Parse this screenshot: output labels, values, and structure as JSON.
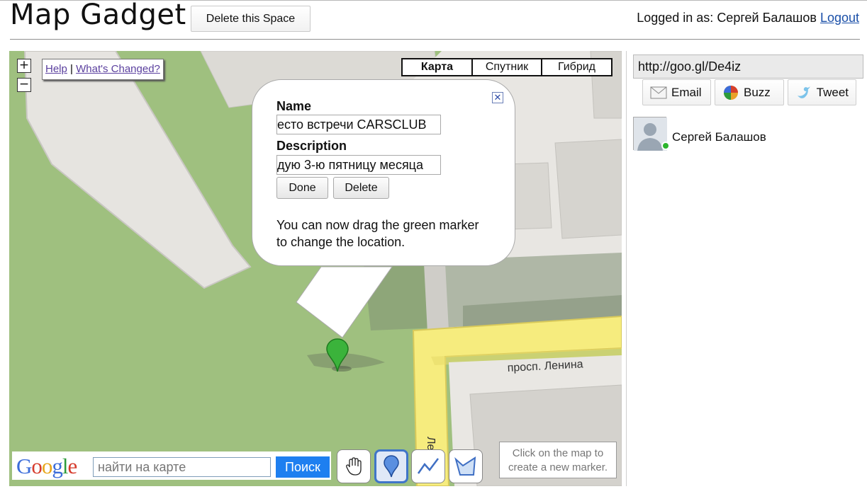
{
  "header": {
    "app_title": "Map Gadget",
    "delete_space_label": "Delete this Space",
    "logged_in_prefix": "Logged in as:",
    "user_name": "Сергей Балашов",
    "logout_label": "Logout"
  },
  "map": {
    "zoom_in_label": "+",
    "zoom_out_label": "−",
    "help_label": "Help",
    "help_separator": "|",
    "whats_changed_label": "What's Changed?",
    "map_types": [
      "Карта",
      "Спутник",
      "Гибрид"
    ],
    "selected_map_type": "Карта",
    "street_label_main": "просп. Ленина",
    "street_label_side": "Ле",
    "infowindow": {
      "name_label": "Name",
      "name_value": "есто встречи CARSCLUB",
      "description_label": "Description",
      "description_value": "дую 3-ю пятницу месяца",
      "done_label": "Done",
      "delete_label": "Delete",
      "note": "You can now drag the green marker to change the location."
    },
    "search": {
      "logo_text": "Google",
      "placeholder": "найти на карте",
      "button_label": "Поиск"
    },
    "tools": [
      "hand-icon",
      "marker-icon",
      "line-icon",
      "polygon-icon"
    ],
    "click_hint": "Click on the map to create a new marker."
  },
  "sidebar": {
    "short_url": "http://goo.gl/De4iz",
    "share_buttons": [
      {
        "label": "Email",
        "icon": "envelope-icon"
      },
      {
        "label": "Buzz",
        "icon": "buzz-icon"
      },
      {
        "label": "Tweet",
        "icon": "twitter-bird-icon"
      }
    ],
    "participant_name": "Сергей Балашов",
    "presence_color": "#2cb52c"
  },
  "colors": {
    "map_green": "#9fc07f",
    "road_yellow": "#f6ec7e",
    "search_blue": "#1e7ff0",
    "marker_green": "#3bb33b"
  }
}
